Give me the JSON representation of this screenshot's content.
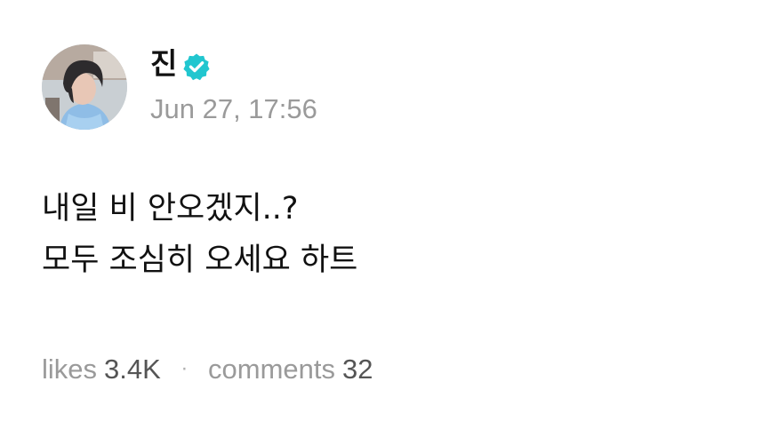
{
  "post": {
    "author": {
      "name": "진",
      "verified": true,
      "avatar_icon": "profile-photo"
    },
    "timestamp": "Jun 27, 17:56",
    "body_lines": [
      "내일 비 안오겠지..?",
      "모두 조심히 오세요 하트"
    ],
    "stats": {
      "likes_label": "likes",
      "likes_value": "3.4K",
      "separator": "·",
      "comments_label": "comments",
      "comments_value": "32"
    }
  },
  "colors": {
    "verified_badge": "#21c6cf",
    "secondary_text": "#9a9a9a",
    "primary_text": "#111111"
  }
}
